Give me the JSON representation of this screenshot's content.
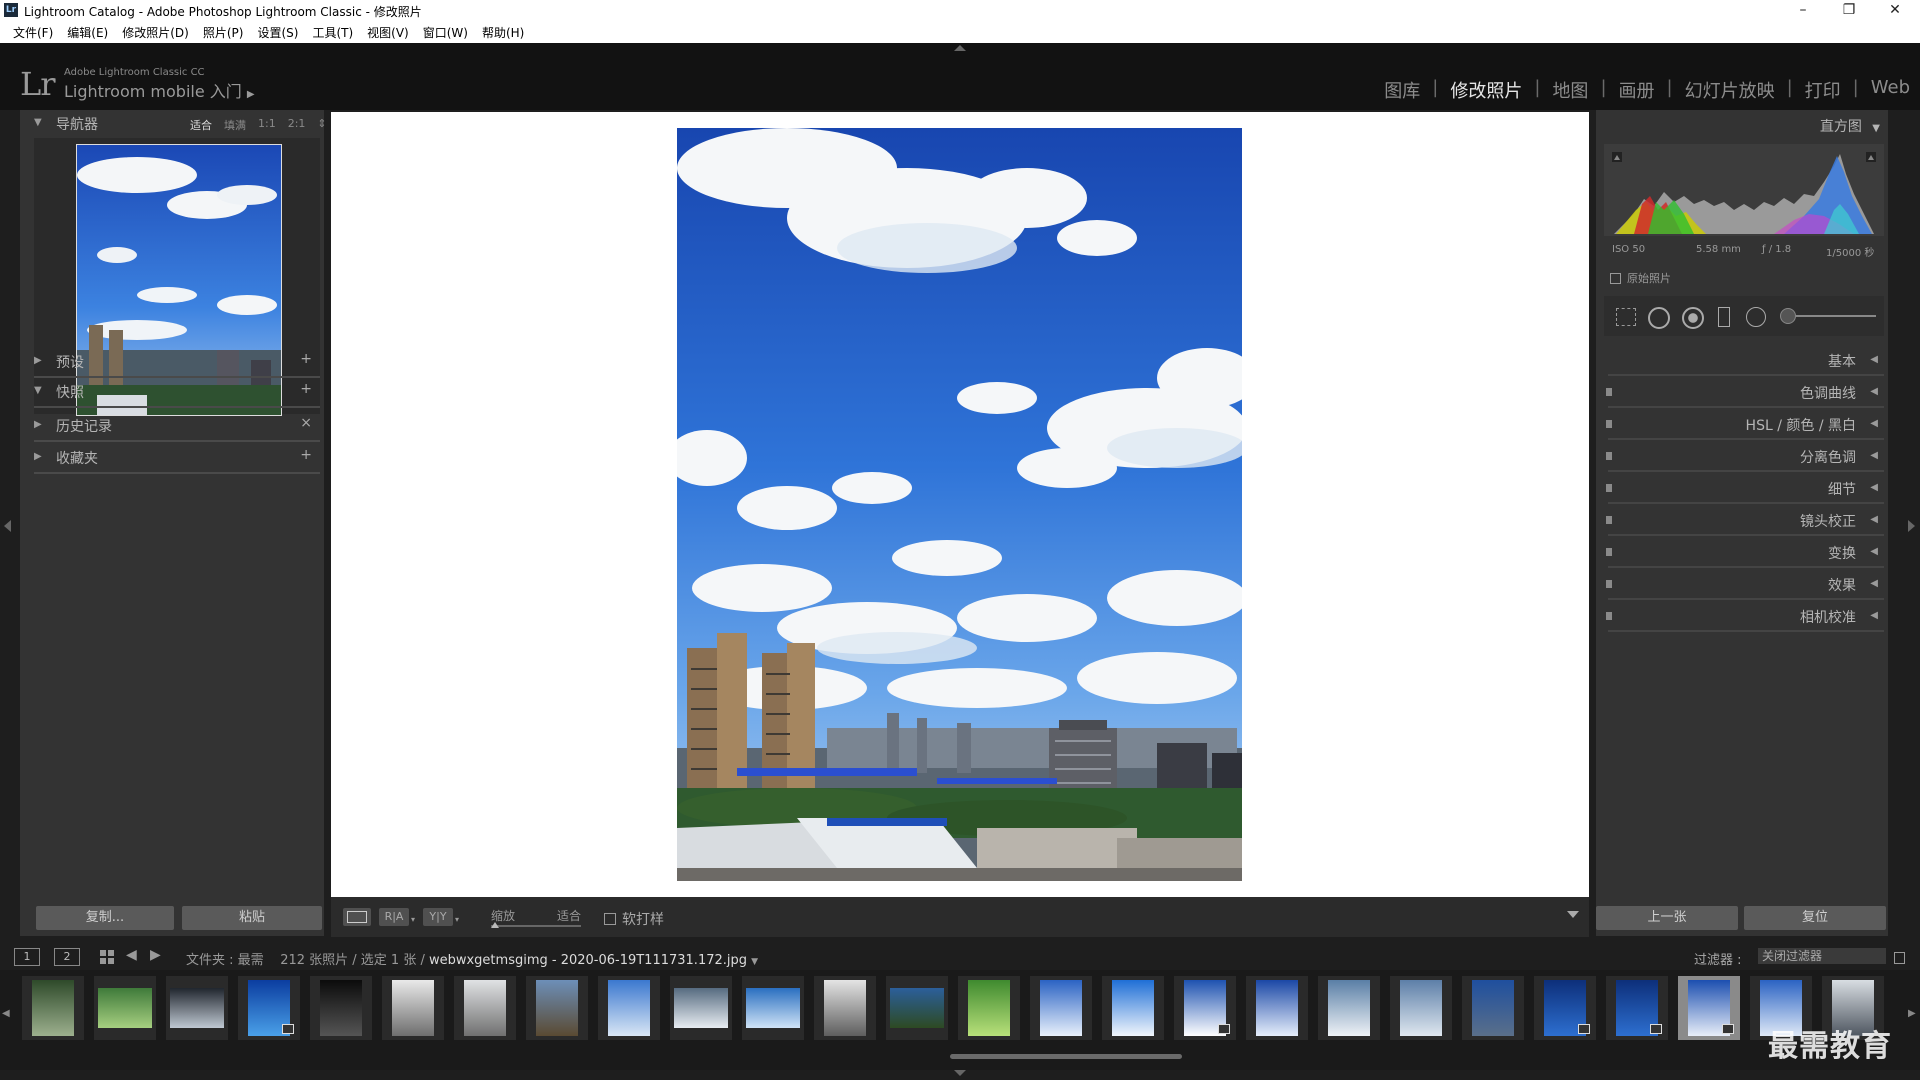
{
  "window": {
    "app_icon": "Lr",
    "title": "Lightroom Catalog - Adobe Photoshop Lightroom Classic - 修改照片",
    "controls": [
      "–",
      "❐",
      "✕"
    ]
  },
  "menu": [
    "文件(F)",
    "编辑(E)",
    "修改照片(D)",
    "照片(P)",
    "设置(S)",
    "工具(T)",
    "视图(V)",
    "窗口(W)",
    "帮助(H)"
  ],
  "header": {
    "logo": "Lr",
    "product": "Adobe Lightroom Classic CC",
    "mobile": "Lightroom mobile 入门",
    "modules": [
      {
        "label": "图库"
      },
      {
        "label": "修改照片",
        "active": true
      },
      {
        "label": "地图"
      },
      {
        "label": "画册"
      },
      {
        "label": "幻灯片放映"
      },
      {
        "label": "打印"
      },
      {
        "label": "Web"
      }
    ]
  },
  "left_panel": {
    "navigator": {
      "title": "导航器",
      "zoom": [
        "适合",
        "填满",
        "1:1",
        "2:1"
      ],
      "zoom_selected": "适合"
    },
    "sections": [
      {
        "label": "预设",
        "action": "+"
      },
      {
        "label": "快照",
        "action": "+"
      },
      {
        "label": "历史记录",
        "action": "×"
      },
      {
        "label": "收藏夹",
        "action": "+"
      }
    ],
    "copy_button": "复制...",
    "paste_button": "粘贴"
  },
  "toolbar": {
    "ra_label": "R|A",
    "yy_label": "Y|Y",
    "zoom_label": "缩放",
    "zoom_value": "适合",
    "soft_proof": "软打样"
  },
  "right_panel": {
    "histogram": {
      "title": "直方图",
      "iso": "ISO 50",
      "focal": "5.58 mm",
      "aperture": "ƒ / 1.8",
      "shutter": "1/5000 秒",
      "original_photo": "原始照片"
    },
    "sections": [
      {
        "label": "基本"
      },
      {
        "label": "色调曲线"
      },
      {
        "label": "HSL / 颜色 / 黑白"
      },
      {
        "label": "分离色调"
      },
      {
        "label": "细节"
      },
      {
        "label": "镜头校正"
      },
      {
        "label": "变换"
      },
      {
        "label": "效果"
      },
      {
        "label": "相机校准"
      }
    ],
    "prev_button": "上一张",
    "reset_button": "复位"
  },
  "filmstrip_bar": {
    "page1": "1",
    "page2": "2",
    "folder_label": "文件夹 : 最需",
    "count": "212 张照片 / 选定 1 张 /",
    "filename": "webwxgetmsgimg - 2020-06-19T111731.172.jpg",
    "filter_label": "过滤器 :",
    "filter_value": "关闭过滤器"
  },
  "filmstrip": {
    "selected_index": 23,
    "thumbs": [
      {
        "colors": [
          "#2e4a2a",
          "#9db08e"
        ],
        "shape": "tall"
      },
      {
        "colors": [
          "#3f7a3a",
          "#a6cf80"
        ],
        "shape": "wide"
      },
      {
        "colors": [
          "#20262e",
          "#bfc8d2"
        ],
        "shape": "wide"
      },
      {
        "colors": [
          "#0b3da0",
          "#4aa0e8"
        ],
        "shape": "tall",
        "badge": true
      },
      {
        "colors": [
          "#0b0b0b",
          "#555555"
        ],
        "shape": "tall"
      },
      {
        "colors": [
          "#e9e9e9",
          "#6e6e6e"
        ],
        "shape": "tall"
      },
      {
        "colors": [
          "#e0e2e4",
          "#707070"
        ],
        "shape": "tall"
      },
      {
        "colors": [
          "#6d8fb8",
          "#5a4a32"
        ],
        "shape": "tall"
      },
      {
        "colors": [
          "#3b78cf",
          "#d9e6f5"
        ],
        "shape": "tall"
      },
      {
        "colors": [
          "#566b80",
          "#e8edf2"
        ],
        "shape": "wide"
      },
      {
        "colors": [
          "#2a6fc0",
          "#cfe3f6"
        ],
        "shape": "wide"
      },
      {
        "colors": [
          "#e4e4e4",
          "#5e5e5e"
        ],
        "shape": "tall"
      },
      {
        "colors": [
          "#2c5f9a",
          "#2d4a22"
        ],
        "shape": "wide"
      },
      {
        "colors": [
          "#3f8a2f",
          "#b8e07a"
        ],
        "shape": "tall"
      },
      {
        "colors": [
          "#2b63c3",
          "#e9f1fb"
        ],
        "shape": "tall"
      },
      {
        "colors": [
          "#1f6fd6",
          "#f1f6fc"
        ],
        "shape": "tall"
      },
      {
        "colors": [
          "#1e52b0",
          "#ffffff"
        ],
        "shape": "tall",
        "badge": true
      },
      {
        "colors": [
          "#1b48a6",
          "#e6eefb"
        ],
        "shape": "tall"
      },
      {
        "colors": [
          "#5a7fa6",
          "#eef2f6"
        ],
        "shape": "tall"
      },
      {
        "colors": [
          "#5d7fa8",
          "#dfe7ef"
        ],
        "shape": "tall"
      },
      {
        "colors": [
          "#1f4f9e",
          "#5a6f8a"
        ],
        "shape": "tall"
      },
      {
        "colors": [
          "#0d2f7a",
          "#2d6fd0"
        ],
        "shape": "tall",
        "badge": true
      },
      {
        "colors": [
          "#0d2f7a",
          "#2d6fd0"
        ],
        "shape": "tall",
        "badge": true
      },
      {
        "colors": [
          "#1c4fb0",
          "#e8eef8"
        ],
        "shape": "tall",
        "badge": true
      },
      {
        "colors": [
          "#2b63c3",
          "#dfe9f7"
        ],
        "shape": "tall"
      },
      {
        "colors": [
          "#d8dde2",
          "#4e5660"
        ],
        "shape": "tall"
      }
    ]
  },
  "watermark": "最需教育",
  "colors": {
    "panel_bg": "#333333",
    "sky_top": "#1b48b5",
    "sky_mid": "#3c82e0",
    "cloud": "#f4f6f8"
  }
}
